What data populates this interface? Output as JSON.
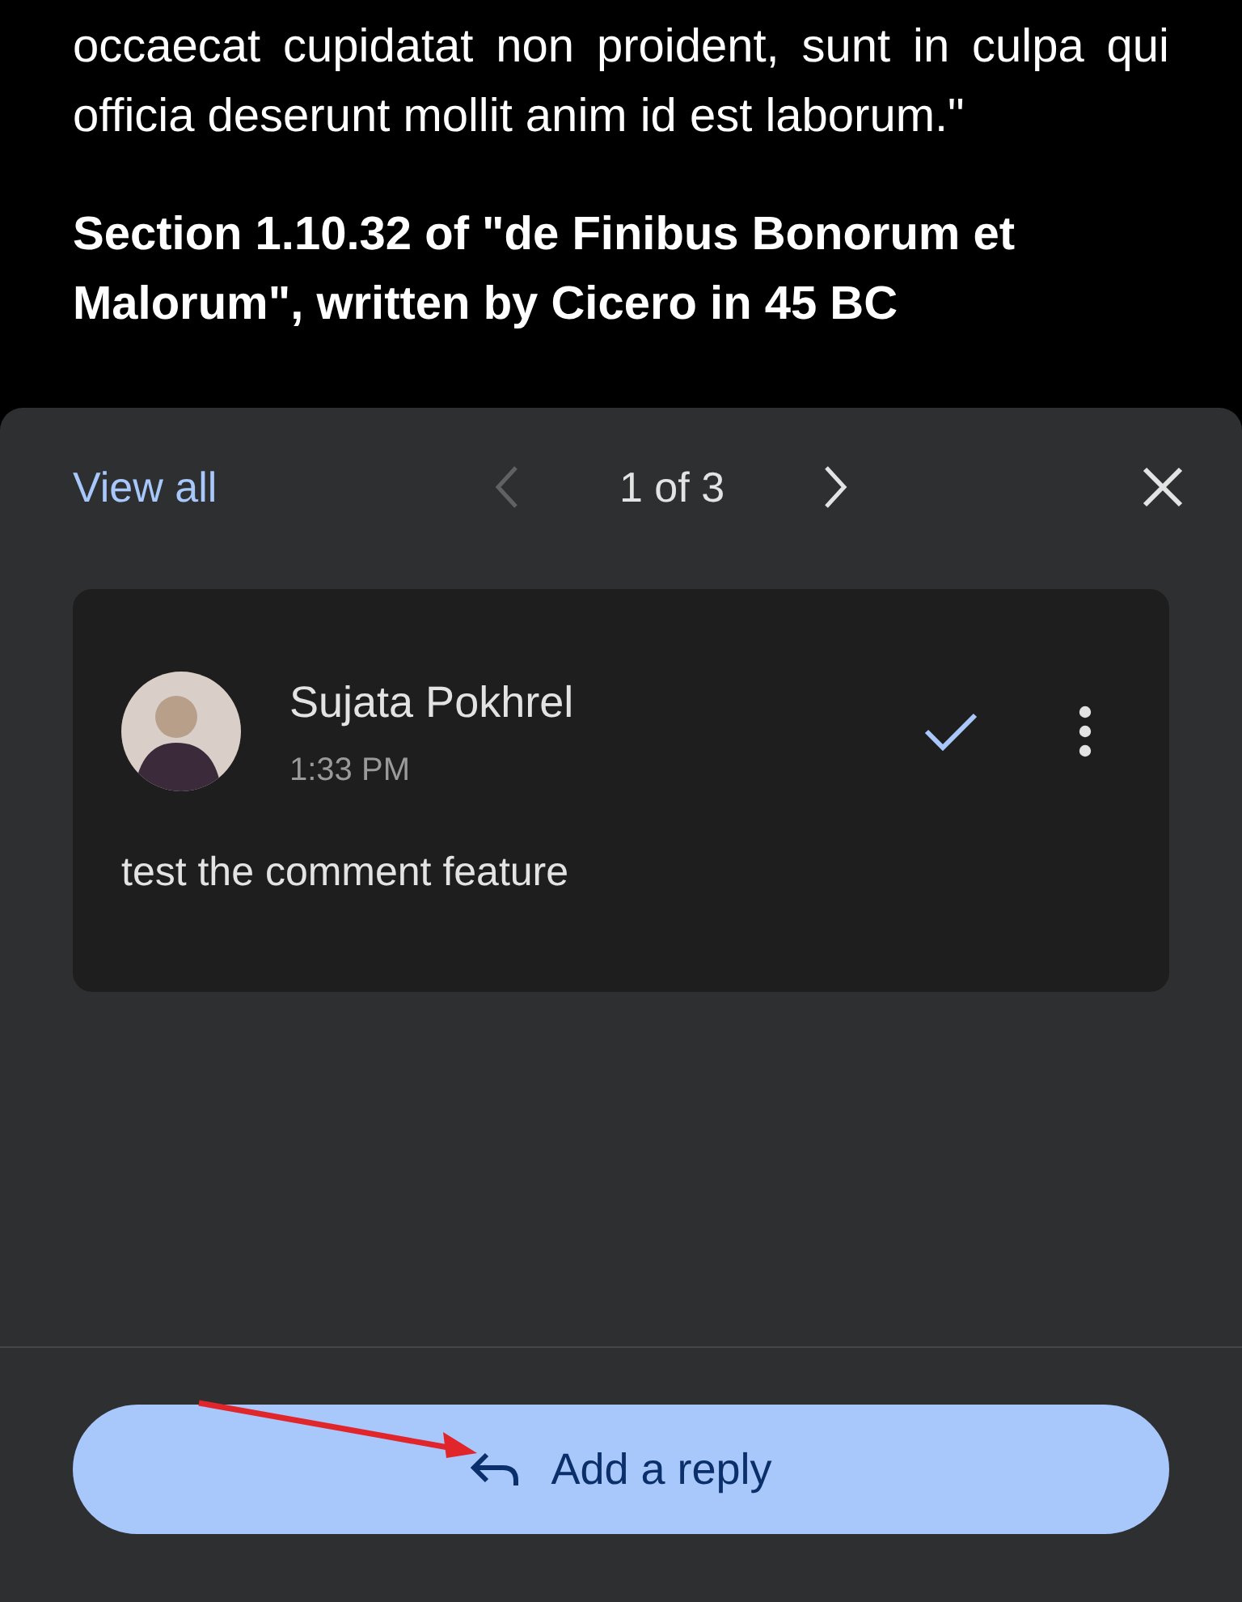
{
  "document": {
    "paragraph": "occaecat cupidatat non proident, sunt in culpa qui officia deserunt mollit anim id est laborum.\"",
    "heading": "Section 1.10.32 of \"de Finibus Bonorum et Malorum\", written by Cicero in 45 BC"
  },
  "comments_sheet": {
    "view_all": "View all",
    "counter": "1 of 3",
    "nav": [
      {
        "kind": "prev",
        "disabled": true
      },
      {
        "kind": "next",
        "disabled": false
      }
    ],
    "comment": {
      "author": "Sujata Pokhrel",
      "time": "1:33 PM",
      "text": "test the comment feature"
    },
    "reply_button": "Add a reply"
  }
}
